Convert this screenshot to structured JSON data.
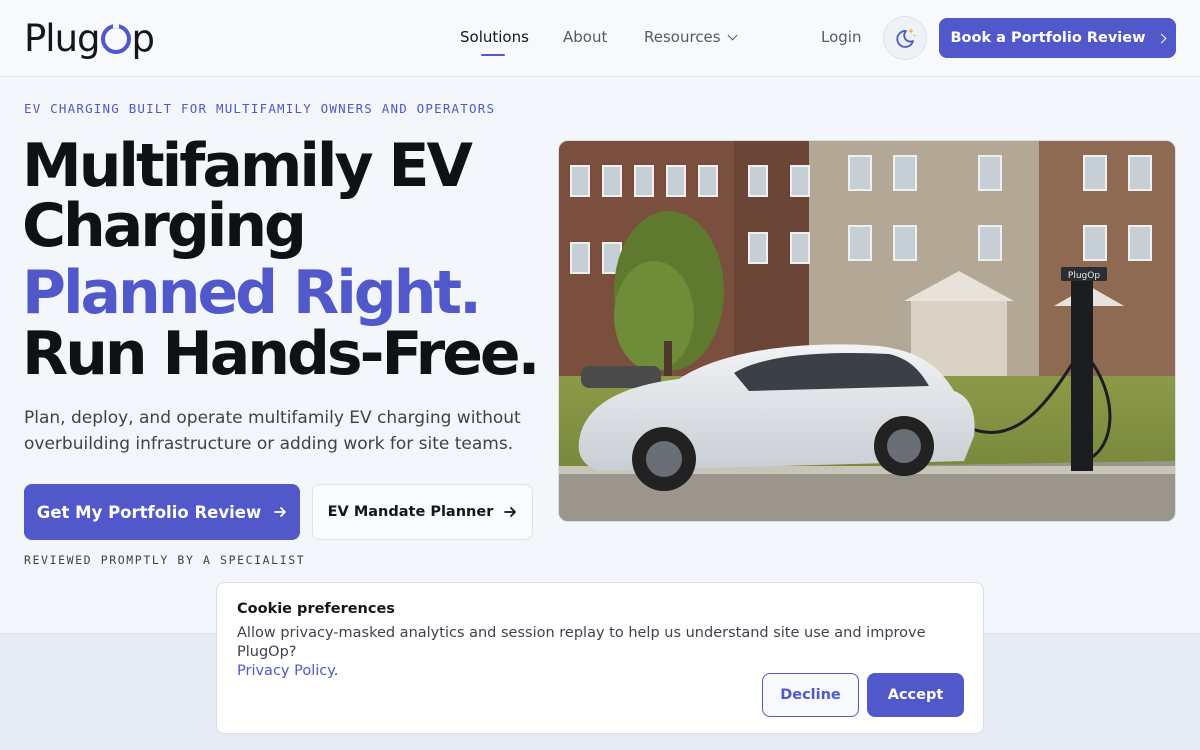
{
  "header": {
    "logo_text_left": "Plug",
    "logo_text_right": "p",
    "nav": {
      "solutions": "Solutions",
      "about": "About",
      "resources": "Resources"
    },
    "login": "Login",
    "theme_icon": "moon-star-icon",
    "book_cta": "Book a Portfolio Review"
  },
  "hero": {
    "eyebrow": "EV CHARGING BUILT FOR MULTIFAMILY OWNERS AND OPERATORS",
    "headline_line1": "Multifamily EV",
    "headline_line2": "Charging",
    "headline_accent": "Planned Right.",
    "headline_line4": "Run Hands-Free.",
    "lede": "Plan, deploy, and operate multifamily EV charging without overbuilding infrastructure or adding work for site teams.",
    "primary_cta": "Get My Portfolio Review",
    "secondary_cta": "EV Mandate Planner",
    "reviewed_note": "REVIEWED PROMPTLY BY A SPECIALIST",
    "charger_brand": "PlugOp"
  },
  "cookie": {
    "title": "Cookie preferences",
    "body": "Allow privacy-masked analytics and session replay to help us understand site use and improve PlugOp?",
    "policy_link": "Privacy Policy",
    "decline": "Decline",
    "accept": "Accept"
  },
  "colors": {
    "brand": "#5158c9",
    "background": "#f3f6fb",
    "text": "#0f1115"
  }
}
